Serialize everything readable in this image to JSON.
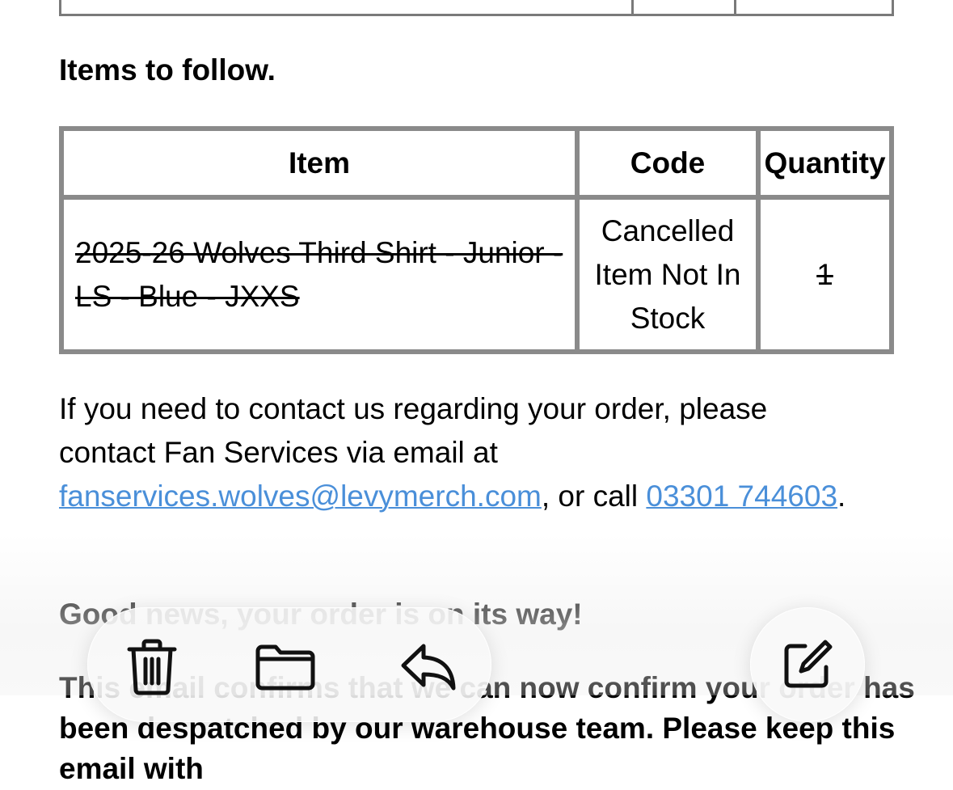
{
  "email": {
    "heading": "Items to follow.",
    "table": {
      "headers": [
        "Item",
        "Code",
        "Quantity"
      ],
      "rows": [
        {
          "item": "2025-26 Wolves Third Shirt - Junior - LS - Blue - JXXS",
          "code": "Cancelled Item Not In Stock",
          "quantity": "1"
        }
      ]
    },
    "contact": {
      "text_before": "If you need to contact us regarding your order, please contact Fan Services via email at ",
      "email_link": "fanservices.wolves@levymerch.com",
      "text_middle": ", or call ",
      "phone_link": "03301 744603",
      "text_after": "."
    },
    "good_news": "Good news, your order is on its way!",
    "body_text": "This email confirms that we can now confirm your order has been despatched by our warehouse team. Please keep this email with"
  },
  "toolbar": {
    "icons": [
      "trash-icon",
      "folder-icon",
      "reply-icon"
    ],
    "compose_icon": "compose-icon"
  }
}
